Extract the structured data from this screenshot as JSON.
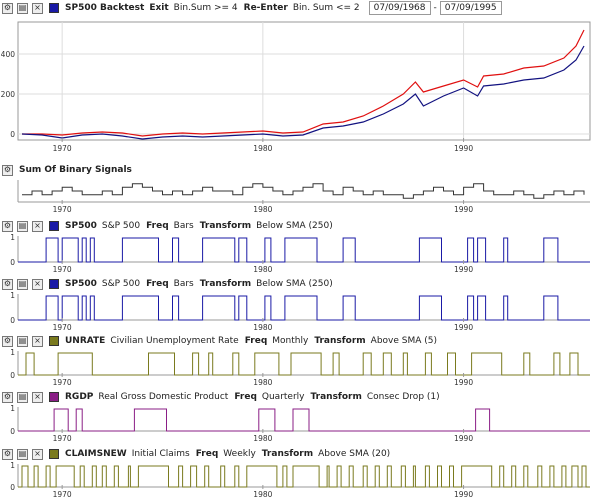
{
  "main": {
    "name": "SP500 Backtest",
    "color": "#1a1aa6",
    "exit_label": "Exit",
    "exit_rule": "Bin.Sum >= 4",
    "reenter_label": "Re-Enter",
    "reenter_rule": "Bin. Sum <= 2",
    "start_date": "07/09/1968",
    "date_sep": "-",
    "end_date": "07/09/1995",
    "chart_data": {
      "type": "line",
      "x_range": [
        1967.8,
        1996.3
      ],
      "ylim": [
        -30,
        560
      ],
      "yticks": [
        "0",
        "200",
        "400"
      ],
      "xticks": [
        "1970",
        "1980",
        "1990"
      ],
      "series": [
        {
          "color": "#e01010",
          "x": [
            1968,
            1969,
            1970,
            1971,
            1972,
            1973,
            1974,
            1975,
            1976,
            1977,
            1978,
            1979,
            1980,
            1981,
            1982,
            1983,
            1984,
            1985,
            1986,
            1987,
            1987.6,
            1988,
            1989,
            1990,
            1990.7,
            1991,
            1992,
            1993,
            1994,
            1995,
            1995.6,
            1996
          ],
          "values": [
            0,
            0,
            -5,
            5,
            10,
            5,
            -10,
            0,
            5,
            0,
            5,
            10,
            15,
            5,
            10,
            50,
            60,
            90,
            140,
            200,
            260,
            210,
            240,
            270,
            235,
            290,
            300,
            330,
            340,
            380,
            440,
            520
          ]
        },
        {
          "color": "#121280",
          "x": [
            1968,
            1969,
            1970,
            1971,
            1972,
            1973,
            1974,
            1975,
            1976,
            1977,
            1978,
            1979,
            1980,
            1981,
            1982,
            1983,
            1984,
            1985,
            1986,
            1987,
            1987.6,
            1988,
            1989,
            1990,
            1990.7,
            1991,
            1992,
            1993,
            1994,
            1995,
            1995.6,
            1996
          ],
          "values": [
            0,
            -5,
            -20,
            -5,
            0,
            -10,
            -25,
            -15,
            -10,
            -15,
            -10,
            -5,
            0,
            -10,
            -5,
            30,
            40,
            60,
            100,
            150,
            200,
            140,
            190,
            230,
            190,
            240,
            250,
            270,
            280,
            320,
            370,
            440
          ]
        }
      ]
    }
  },
  "panels": [
    {
      "key": "sum",
      "name": "Sum Of Binary Signals",
      "color": "#333333",
      "chart_data": {
        "type": "line",
        "x_range": [
          1967.8,
          1996.3
        ],
        "xticks": [
          "1970",
          "1980",
          "1990"
        ],
        "ylim": [
          0,
          6
        ],
        "x": [
          1968,
          1968.5,
          1969,
          1969.5,
          1970,
          1970.5,
          1971,
          1971.5,
          1972,
          1972.5,
          1973,
          1973.5,
          1974,
          1974.5,
          1975,
          1975.5,
          1976,
          1976.5,
          1977,
          1977.5,
          1978,
          1978.5,
          1979,
          1979.5,
          1980,
          1980.5,
          1981,
          1981.5,
          1982,
          1982.5,
          1983,
          1983.5,
          1984,
          1984.5,
          1985,
          1985.5,
          1986,
          1986.5,
          1987,
          1987.5,
          1988,
          1988.5,
          1989,
          1989.5,
          1990,
          1990.5,
          1991,
          1991.5,
          1992,
          1992.5,
          1993,
          1993.5,
          1994,
          1994.5,
          1995,
          1995.5,
          1996
        ],
        "values": [
          2,
          3,
          2,
          3,
          4,
          3,
          2,
          2,
          3,
          2,
          4,
          5,
          4,
          3,
          2,
          3,
          2,
          3,
          4,
          3,
          3,
          2,
          4,
          5,
          4,
          3,
          2,
          3,
          4,
          5,
          3,
          2,
          4,
          3,
          2,
          3,
          2,
          2,
          1,
          2,
          3,
          4,
          3,
          2,
          4,
          5,
          3,
          2,
          2,
          3,
          2,
          1,
          2,
          3,
          2,
          3,
          2
        ]
      }
    },
    {
      "key": "sp1",
      "name": "SP500",
      "desc": "S&P 500",
      "freq_label": "Freq",
      "freq": "Bars",
      "transform_label": "Transform",
      "transform": "Below SMA (250)",
      "color": "#1a1aa6",
      "chart_data": {
        "type": "step",
        "x_range": [
          1967.8,
          1996.3
        ],
        "xticks": [
          "1970",
          "1980",
          "1990"
        ],
        "ylim": [
          0,
          1
        ],
        "intervals": [
          [
            1969.2,
            1969.8
          ],
          [
            1970.0,
            1970.8
          ],
          [
            1971.0,
            1971.2
          ],
          [
            1971.4,
            1971.6
          ],
          [
            1973.0,
            1974.8
          ],
          [
            1975.5,
            1975.8
          ],
          [
            1977.0,
            1978.6
          ],
          [
            1978.8,
            1979.2
          ],
          [
            1980.1,
            1980.4
          ],
          [
            1981.1,
            1982.7
          ],
          [
            1984.0,
            1984.6
          ],
          [
            1987.8,
            1988.9
          ],
          [
            1990.2,
            1990.5
          ],
          [
            1990.7,
            1991.1
          ],
          [
            1992.0,
            1992.2
          ],
          [
            1994.0,
            1994.7
          ]
        ]
      }
    },
    {
      "key": "sp2",
      "name": "SP500",
      "desc": "S&P 500",
      "freq_label": "Freq",
      "freq": "Bars",
      "transform_label": "Transform",
      "transform": "Below SMA (250)",
      "color": "#1a1aa6",
      "chart_data": {
        "type": "step",
        "x_range": [
          1967.8,
          1996.3
        ],
        "xticks": [
          "1970",
          "1980",
          "1990"
        ],
        "ylim": [
          0,
          1
        ],
        "intervals": [
          [
            1969.2,
            1969.8
          ],
          [
            1970.0,
            1970.8
          ],
          [
            1971.0,
            1971.2
          ],
          [
            1971.4,
            1971.6
          ],
          [
            1973.0,
            1974.8
          ],
          [
            1975.5,
            1975.8
          ],
          [
            1977.0,
            1978.6
          ],
          [
            1978.8,
            1979.2
          ],
          [
            1980.1,
            1980.4
          ],
          [
            1981.1,
            1982.7
          ],
          [
            1984.0,
            1984.6
          ],
          [
            1987.8,
            1988.9
          ],
          [
            1990.2,
            1990.5
          ],
          [
            1990.7,
            1991.1
          ],
          [
            1992.0,
            1992.2
          ],
          [
            1994.0,
            1994.7
          ]
        ]
      }
    },
    {
      "key": "unrate",
      "name": "UNRATE",
      "desc": "Civilian Unemployment Rate",
      "freq_label": "Freq",
      "freq": "Monthly",
      "transform_label": "Transform",
      "transform": "Above SMA (5)",
      "color": "#7a7a1e",
      "chart_data": {
        "type": "step",
        "x_range": [
          1967.8,
          1996.3
        ],
        "xticks": [
          "1970",
          "1980",
          "1990"
        ],
        "ylim": [
          0,
          1
        ],
        "intervals": [
          [
            1968.2,
            1968.6
          ],
          [
            1969.8,
            1971.5
          ],
          [
            1974.3,
            1975.6
          ],
          [
            1976.5,
            1976.8
          ],
          [
            1977.3,
            1977.5
          ],
          [
            1978.5,
            1978.8
          ],
          [
            1979.6,
            1980.8
          ],
          [
            1981.4,
            1982.9
          ],
          [
            1983.5,
            1983.8
          ],
          [
            1985.0,
            1985.4
          ],
          [
            1986.0,
            1986.4
          ],
          [
            1987.0,
            1987.2
          ],
          [
            1988.1,
            1988.4
          ],
          [
            1989.2,
            1989.6
          ],
          [
            1990.4,
            1991.9
          ],
          [
            1993.0,
            1993.3
          ],
          [
            1994.5,
            1994.8
          ],
          [
            1995.3,
            1995.7
          ]
        ]
      }
    },
    {
      "key": "rgdp",
      "name": "RGDP",
      "desc": "Real Gross Domestic Product",
      "freq_label": "Freq",
      "freq": "Quarterly",
      "transform_label": "Transform",
      "transform": "Consec Drop (1)",
      "color": "#8a1e86",
      "chart_data": {
        "type": "step",
        "x_range": [
          1967.8,
          1996.3
        ],
        "xticks": [
          "1970",
          "1980",
          "1990"
        ],
        "ylim": [
          0,
          1
        ],
        "intervals": [
          [
            1969.6,
            1970.3
          ],
          [
            1970.7,
            1971.0
          ],
          [
            1973.6,
            1975.2
          ],
          [
            1979.8,
            1980.6
          ],
          [
            1981.5,
            1982.3
          ],
          [
            1990.6,
            1991.3
          ]
        ]
      }
    },
    {
      "key": "claims",
      "name": "CLAIMSNEW",
      "desc": "Initial Claims",
      "freq_label": "Freq",
      "freq": "Weekly",
      "transform_label": "Transform",
      "transform": "Above SMA (20)",
      "color": "#7a7a1e",
      "chart_data": {
        "type": "step",
        "x_range": [
          1967.8,
          1996.3
        ],
        "xticks": [
          "1970",
          "1980",
          "1990"
        ],
        "ylim": [
          0,
          1
        ],
        "intervals": [
          [
            1968.0,
            1968.3
          ],
          [
            1968.6,
            1968.8
          ],
          [
            1969.2,
            1969.4
          ],
          [
            1969.7,
            1970.6
          ],
          [
            1970.9,
            1971.1
          ],
          [
            1971.5,
            1971.7
          ],
          [
            1972.0,
            1972.2
          ],
          [
            1972.6,
            1972.8
          ],
          [
            1973.3,
            1973.4
          ],
          [
            1973.8,
            1975.3
          ],
          [
            1975.8,
            1976.0
          ],
          [
            1976.4,
            1976.7
          ],
          [
            1977.1,
            1977.3
          ],
          [
            1977.9,
            1978.1
          ],
          [
            1978.6,
            1978.8
          ],
          [
            1979.2,
            1980.7
          ],
          [
            1981.0,
            1981.2
          ],
          [
            1981.5,
            1982.8
          ],
          [
            1983.2,
            1983.3
          ],
          [
            1983.7,
            1983.9
          ],
          [
            1984.3,
            1984.5
          ],
          [
            1985.0,
            1985.2
          ],
          [
            1985.6,
            1985.8
          ],
          [
            1986.2,
            1986.4
          ],
          [
            1986.9,
            1987.1
          ],
          [
            1987.5,
            1987.6
          ],
          [
            1988.1,
            1988.3
          ],
          [
            1988.7,
            1988.9
          ],
          [
            1989.3,
            1989.5
          ],
          [
            1989.9,
            1991.4
          ],
          [
            1991.8,
            1992.0
          ],
          [
            1992.4,
            1992.6
          ],
          [
            1993.0,
            1993.2
          ],
          [
            1993.7,
            1993.9
          ],
          [
            1994.3,
            1994.5
          ],
          [
            1994.9,
            1995.1
          ],
          [
            1995.4,
            1995.7
          ],
          [
            1995.9,
            1996.1
          ]
        ]
      }
    }
  ],
  "icons": {
    "gear": "gear-icon",
    "copy": "copy-icon",
    "close": "close-icon"
  }
}
